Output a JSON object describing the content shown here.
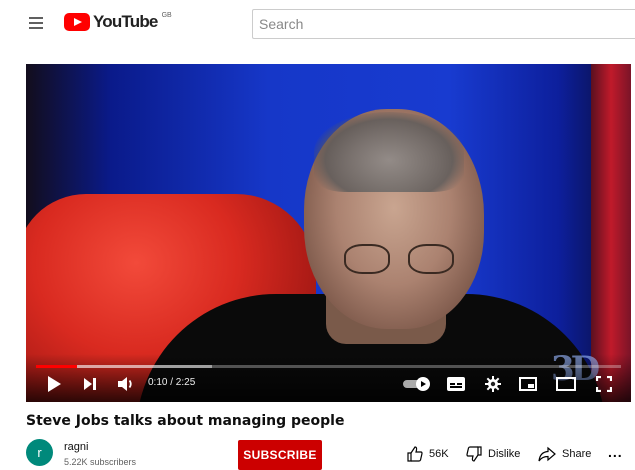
{
  "header": {
    "logo_text": "YouTube",
    "region": "GB",
    "search_placeholder": "Search"
  },
  "player": {
    "time": "0:10 / 2:25",
    "progress_played_fraction": 0.07,
    "progress_loaded_fraction": 0.3,
    "watermark": "3D",
    "icons": [
      "play-icon",
      "next-icon",
      "volume-icon",
      "autoplay-toggle-icon",
      "subtitles-icon",
      "settings-icon",
      "miniplayer-icon",
      "theater-icon",
      "fullscreen-icon"
    ]
  },
  "video": {
    "title": "Steve Jobs talks about managing people"
  },
  "channel": {
    "avatar_letter": "r",
    "avatar_color": "#00897b",
    "name": "ragni",
    "subscribers": "5.22K subscribers",
    "subscribe_label": "SUBSCRIBE"
  },
  "actions": {
    "likes": "56K",
    "dislike_label": "Dislike",
    "share_label": "Share",
    "more_label": "..."
  },
  "colors": {
    "brand_red": "#ff0000",
    "subscribe_red": "#cc0000"
  }
}
